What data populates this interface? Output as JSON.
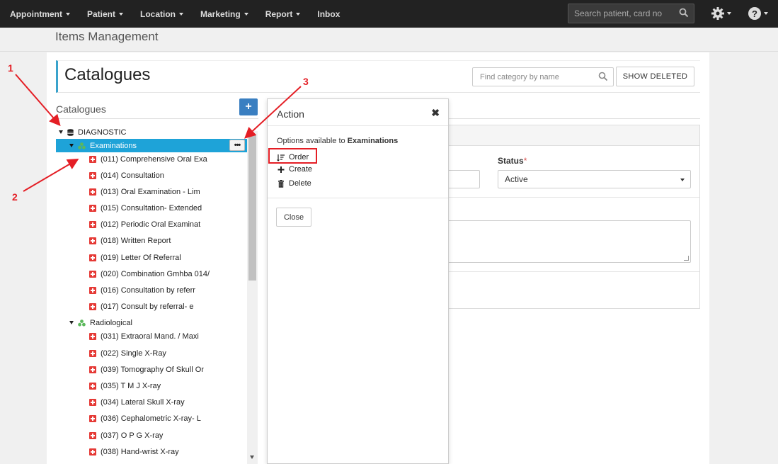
{
  "navbar": {
    "items": [
      "Appointment",
      "Patient",
      "Location",
      "Marketing",
      "Report",
      "Inbox"
    ],
    "search_placeholder": "Search patient, card no"
  },
  "page": {
    "title": "Items Management"
  },
  "catalogues": {
    "heading": "Catalogues",
    "find_placeholder": "Find category by name",
    "show_deleted_label": "SHOW DELETED",
    "left_title": "Catalogues",
    "add_label": "+"
  },
  "tree": {
    "root_label": "DIAGNOSTIC",
    "group1_label": "Examinations",
    "group1_items": [
      "(011) Comprehensive Oral Exa",
      "(014) Consultation",
      "(013) Oral Examination - Lim",
      "(015) Consultation- Extended",
      "(012) Periodic Oral Examinat",
      "(018) Written Report",
      "(019) Letter Of Referral",
      "(020) Combination Gmhba 014/",
      "(016) Consultation by referr",
      "(017) Consult by referral- e"
    ],
    "group2_label": "Radiological",
    "group2_items": [
      "(031) Extraoral Mand. / Maxi",
      "(022) Single X-Ray",
      "(039) Tomography Of Skull Or",
      "(035) T M J X-ray",
      "(034) Lateral Skull X-ray",
      "(036) Cephalometric X-ray- L",
      "(037) O P G X-ray",
      "(038) Hand-wrist X-ray"
    ],
    "dots_label": "•••"
  },
  "form": {
    "status_label": "Status",
    "required_mark": "*",
    "status_value": "Active"
  },
  "popup": {
    "title": "Action",
    "close_glyph": "✖",
    "subtitle_prefix": "Options available to ",
    "subtitle_target": "Examinations",
    "options": [
      "Order",
      "Create",
      "Delete"
    ],
    "close_button": "Close"
  },
  "annotations": [
    "1",
    "2",
    "3"
  ],
  "colors": {
    "navbar_bg": "#222222",
    "selected_row": "#1ea3d8",
    "add_button": "#3a7fc1",
    "accent_border": "#3aa3cc",
    "annotation_red": "#e41e25",
    "item_icon_red": "#e53935",
    "cluster_green": "#5cb85c"
  },
  "icons": {
    "search": "search-icon",
    "gear": "gear-icon",
    "help": "help-icon",
    "database": "database-icon",
    "cluster": "cluster-icon",
    "item": "plus-square-icon",
    "order": "sort-icon",
    "create": "plus-icon",
    "delete": "trash-icon"
  }
}
